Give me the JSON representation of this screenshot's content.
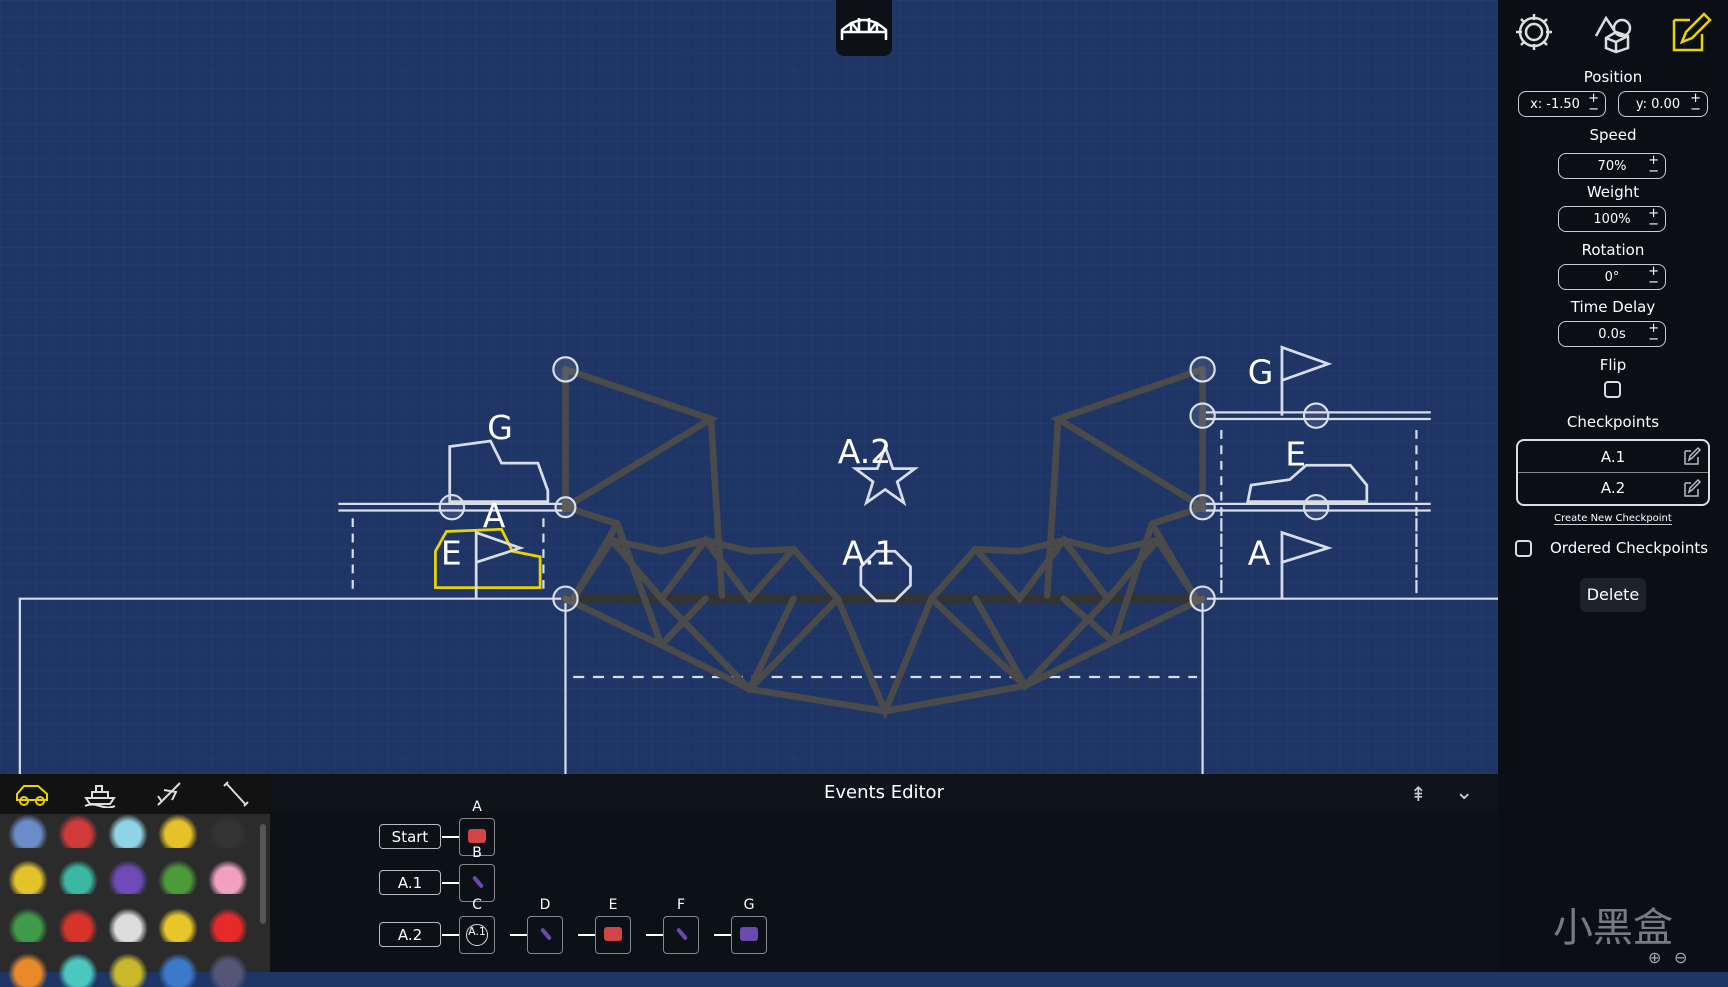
{
  "colors": {
    "background": "#1e3566",
    "accent": "#e8d400",
    "sidebar": "#0b0f15"
  },
  "scene": {
    "labels": {
      "left_g": "G",
      "left_a": "A",
      "left_e": "E",
      "center_a2": "A.2",
      "center_a1": "A.1",
      "right_g": "G",
      "right_e": "E",
      "right_a": "A"
    }
  },
  "top": {
    "icon": "bridge-icon"
  },
  "toolbar": {
    "icons": [
      "gear-icon",
      "shapes-icon",
      "edit-icon"
    ]
  },
  "properties": {
    "position_label": "Position",
    "x_value": "x: -1.50",
    "y_value": "y: 0.00",
    "speed_label": "Speed",
    "speed_value": "70%",
    "weight_label": "Weight",
    "weight_value": "100%",
    "rotation_label": "Rotation",
    "rotation_value": "0°",
    "delay_label": "Time Delay",
    "delay_value": "0.0s",
    "flip_label": "Flip",
    "flip_checked": false,
    "checkpoints_label": "Checkpoints",
    "checkpoints": [
      "A.1",
      "A.2"
    ],
    "create_checkpoint": "Create New Checkpoint",
    "ordered_label": "Ordered Checkpoints",
    "ordered_checked": false,
    "delete_label": "Delete"
  },
  "vehicles": {
    "tabs": [
      "car-icon",
      "boat-icon",
      "plane-icon",
      "wrench-icon"
    ],
    "active_tab": "car-icon",
    "colors": [
      "#6a8cc8",
      "#d23a3a",
      "#8fd3e6",
      "#e7c12a",
      "#333",
      "#e3c22a",
      "#3bb8a3",
      "#6e4bb8",
      "#4c9a3a",
      "#f0a0c0",
      "#3f9a4a",
      "#d8332a",
      "#ddd",
      "#e8c62a",
      "#e52a2a",
      "#e88a2a",
      "#4ac8c0",
      "#c8b82a",
      "#3a7ac8",
      "#557"
    ]
  },
  "events": {
    "title": "Events Editor",
    "rows": [
      {
        "trigger": "Start",
        "steps": [
          {
            "label": "A",
            "icon": "red-truck"
          }
        ]
      },
      {
        "trigger": "A.1",
        "steps": [
          {
            "label": "B",
            "icon": "purple-tool"
          }
        ]
      },
      {
        "trigger": "A.2",
        "steps": [
          {
            "label": "C",
            "icon": "A.1"
          },
          {
            "label": "D",
            "icon": "purple-tool"
          },
          {
            "label": "E",
            "icon": "red-car"
          },
          {
            "label": "F",
            "icon": "purple-tool"
          },
          {
            "label": "G",
            "icon": "purple-car"
          }
        ]
      }
    ]
  },
  "watermark": "小黑盒"
}
